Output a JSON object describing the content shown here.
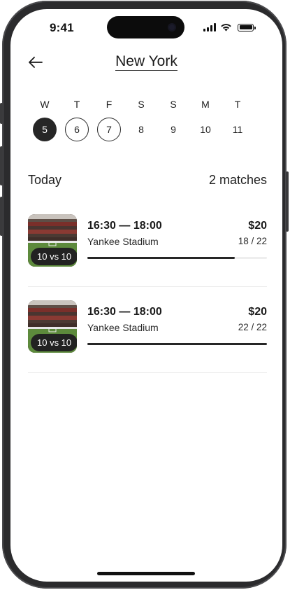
{
  "status_bar": {
    "time": "9:41"
  },
  "header": {
    "title": "New York",
    "back_icon": "arrow-left-icon"
  },
  "week": [
    {
      "letter": "W",
      "number": "5",
      "state": "selected"
    },
    {
      "letter": "T",
      "number": "6",
      "state": "outlined"
    },
    {
      "letter": "F",
      "number": "7",
      "state": "outlined"
    },
    {
      "letter": "S",
      "number": "8",
      "state": "default"
    },
    {
      "letter": "S",
      "number": "9",
      "state": "default"
    },
    {
      "letter": "M",
      "number": "10",
      "state": "default"
    },
    {
      "letter": "T",
      "number": "11",
      "state": "default"
    }
  ],
  "summary": {
    "label": "Today",
    "count": "2 matches"
  },
  "matches": [
    {
      "format": "10 vs 10",
      "time": "16:30 — 18:00",
      "venue": "Yankee Stadium",
      "price": "$20",
      "spots": "18 / 22",
      "filled_fraction": 0.82
    },
    {
      "format": "10 vs 10",
      "time": "16:30 — 18:00",
      "venue": "Yankee Stadium",
      "price": "$20",
      "spots": "22 / 22",
      "filled_fraction": 1.0
    }
  ],
  "colors": {
    "accent": "#262626",
    "track": "#eeeeee",
    "divider": "#ececec"
  }
}
